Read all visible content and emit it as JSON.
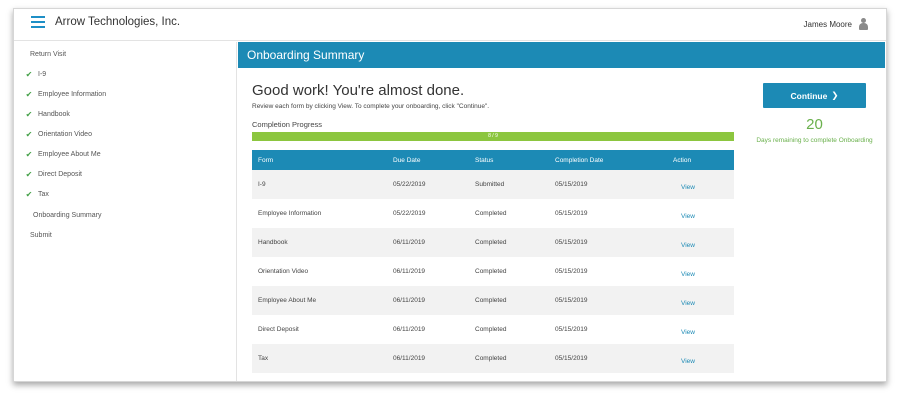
{
  "header": {
    "company": "Arrow Technologies, Inc.",
    "user_name": "James Moore"
  },
  "sidebar": {
    "items": [
      {
        "label": "Return Visit",
        "checked": false
      },
      {
        "label": "I-9",
        "checked": true
      },
      {
        "label": "Employee Information",
        "checked": true
      },
      {
        "label": "Handbook",
        "checked": true
      },
      {
        "label": "Orientation Video",
        "checked": true
      },
      {
        "label": "Employee About Me",
        "checked": true
      },
      {
        "label": "Direct Deposit",
        "checked": true
      },
      {
        "label": "Tax",
        "checked": true
      },
      {
        "label": "Onboarding Summary",
        "checked": false
      },
      {
        "label": "Submit",
        "checked": false
      }
    ]
  },
  "main": {
    "title": "Onboarding Summary",
    "headline": "Good work! You're almost done.",
    "subtext": "Review each form by clicking View. To complete your onboarding, click \"Continue\".",
    "progress_label": "Completion Progress",
    "progress_text": "8 / 9",
    "progress_value": 1.0,
    "continue_label": "Continue",
    "days_remaining": "20",
    "days_remaining_text": "Days remaining to complete Onboarding"
  },
  "table": {
    "headers": [
      "Form",
      "Due Date",
      "Status",
      "Completion Date",
      "Action"
    ],
    "rows": [
      [
        "I-9",
        "05/22/2019",
        "Submitted",
        "05/15/2019",
        "View"
      ],
      [
        "Employee Information",
        "05/22/2019",
        "Completed",
        "05/15/2019",
        "View"
      ],
      [
        "Handbook",
        "06/11/2019",
        "Completed",
        "05/15/2019",
        "View"
      ],
      [
        "Orientation Video",
        "06/11/2019",
        "Completed",
        "05/15/2019",
        "View"
      ],
      [
        "Employee About Me",
        "06/11/2019",
        "Completed",
        "05/15/2019",
        "View"
      ],
      [
        "Direct Deposit",
        "06/11/2019",
        "Completed",
        "05/15/2019",
        "View"
      ],
      [
        "Tax",
        "06/11/2019",
        "Completed",
        "05/15/2019",
        "View"
      ]
    ]
  },
  "colors": {
    "accent": "#1c8ab5",
    "success": "#8cc63f",
    "check": "#43a047"
  }
}
